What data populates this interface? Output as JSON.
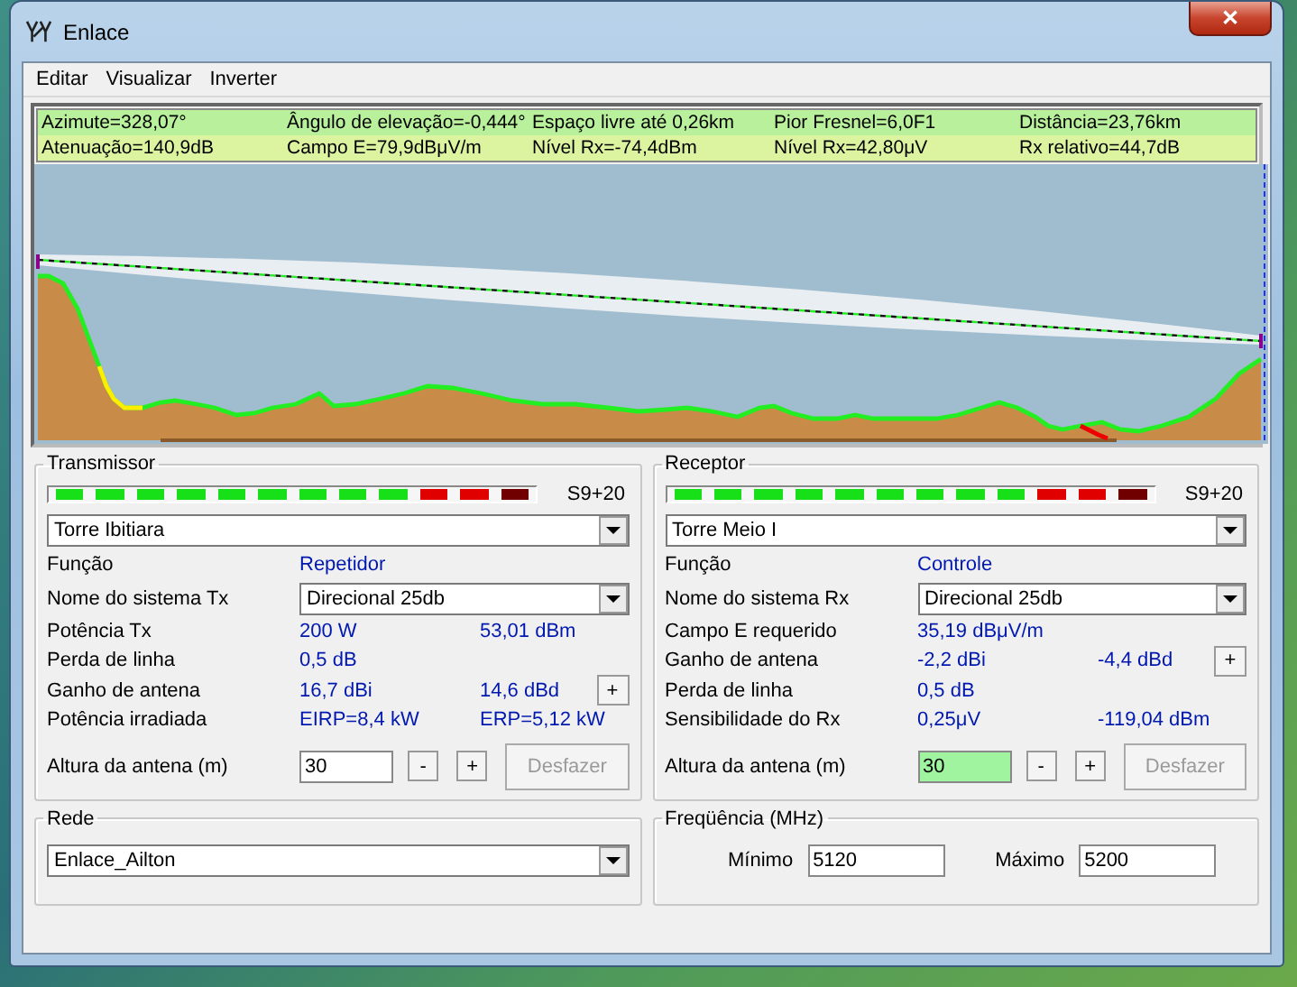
{
  "window": {
    "title": "Enlace",
    "close": "✕"
  },
  "menu": [
    "Editar",
    "Visualizar",
    "Inverter"
  ],
  "info": [
    [
      "Azimute=328,07°",
      "Ângulo de elevação=-0,444°",
      "Espaço livre até 0,26km",
      "Pior Fresnel=6,0F1",
      "Distância=23,76km"
    ],
    [
      "Atenuação=140,9dB",
      "Campo E=79,9dBμV/m",
      "Nível Rx=-74,4dBm",
      "Nível Rx=42,80μV",
      "Rx relativo=44,7dB"
    ]
  ],
  "panels": [
    {
      "title": "Transmissor",
      "meter": {
        "level": 1,
        "reading": "S9+20"
      },
      "station": "Torre Ibitiara",
      "rows": [
        {
          "kind": "text",
          "label": "Função",
          "value": "Repetidor"
        },
        {
          "kind": "select",
          "label": "Nome do sistema Tx",
          "value": "Direcional 25db"
        },
        {
          "kind": "text",
          "label": "Potência Tx",
          "value": "200 W",
          "value_2": "53,01 dBm"
        },
        {
          "kind": "text",
          "label": "Perda de linha",
          "value": "0,5 dB"
        },
        {
          "kind": "text",
          "label": "Ganho de antena",
          "value": "16,7 dBi",
          "value_2": "14,6 dBd",
          "button": "+"
        },
        {
          "kind": "text",
          "label": "Potência irradiada",
          "value": "EIRP=8,4 kW",
          "value_2": "ERP=5,12 kW"
        }
      ],
      "height": {
        "label": "Altura da antena (m)",
        "value": "30",
        "highlighted": false,
        "decrement": "-",
        "increment": "+",
        "undo": "Desfazer",
        "undo_disabled": true
      }
    },
    {
      "title": "Receptor",
      "meter": {
        "level": 1,
        "reading": "S9+20"
      },
      "station": "Torre Meio I",
      "rows": [
        {
          "kind": "text",
          "label": "Função",
          "value": "Controle"
        },
        {
          "kind": "select",
          "label": "Nome do sistema Rx",
          "value": "Direcional 25db"
        },
        {
          "kind": "text",
          "label": "Campo E requerido",
          "value": "35,19 dBμV/m"
        },
        {
          "kind": "text",
          "label": "Ganho de antena",
          "value": "-2,2 dBi",
          "value_2": "-4,4 dBd",
          "button": "+"
        },
        {
          "kind": "text",
          "label": "Perda de linha",
          "value": "0,5 dB"
        },
        {
          "kind": "text",
          "label": "Sensibilidade do Rx",
          "value": "0,25μV",
          "value_2": "-119,04 dBm"
        }
      ],
      "height": {
        "label": "Altura da antena (m)",
        "value": "30",
        "highlighted": true,
        "decrement": "-",
        "increment": "+",
        "undo": "Desfazer",
        "undo_disabled": true
      }
    }
  ],
  "network": {
    "title": "Rede",
    "value": "Enlace_Ailton"
  },
  "frequency": {
    "title": "Freqüência (MHz)",
    "min_label": "Mínimo",
    "min": "5120",
    "max_label": "Máximo",
    "max": "5200"
  }
}
